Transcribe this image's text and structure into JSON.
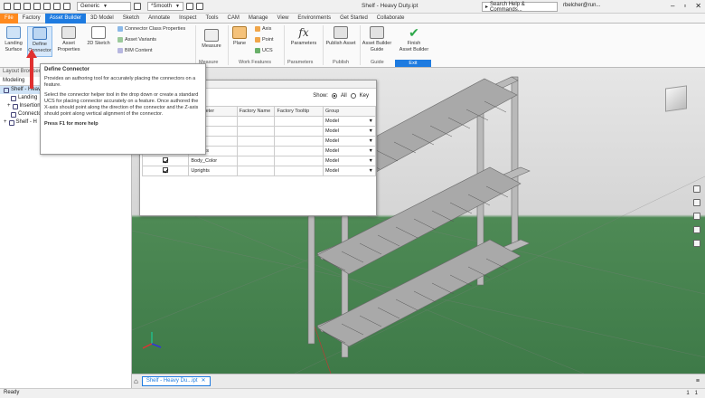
{
  "window": {
    "doc_title": "Shelf - Heavy Duty.ipt",
    "search_placeholder": "Search Help & Commands...",
    "user": "rbelcher@run...",
    "appearance_combo": "Generic",
    "style_combo": "*Smooth"
  },
  "tabs": [
    "File",
    "Factory",
    "Asset Builder",
    "3D Model",
    "Sketch",
    "Annotate",
    "Inspect",
    "Tools",
    "CAM",
    "Manage",
    "View",
    "Environments",
    "Get Started",
    "Collaborate"
  ],
  "active_tab": "Asset Builder",
  "ribbon": {
    "landing_surface": "Landing\nSurface",
    "define_connector": "Define\nConnector",
    "asset_properties": "Asset\nProperties",
    "sketch_2d": "2D Sketch",
    "connector_class_properties": "Connector Class Properties",
    "asset_variants": "Asset Variants",
    "bim_content": "BIM Content",
    "measure": "Measure",
    "plane": "Plane",
    "axis": "Axis",
    "point": "Point",
    "ucs": "UCS",
    "parameters": "Parameters",
    "publish_asset": "Publish Asset",
    "asset_builder_guide": "Asset Builder\nGuide",
    "finish_asset_builder": "Finish\nAsset Builder",
    "groups": {
      "measure": "Measure",
      "work_features": "Work Features",
      "parameters": "Parameters",
      "publish": "Publish",
      "guide": "Guide",
      "exit": "Exit"
    }
  },
  "browser": {
    "title": "Layout Browser",
    "tab": "Modeling",
    "items": [
      "Shelf - Heavy",
      "Landing",
      "Insertion",
      "Connecto",
      "Shelf - H"
    ]
  },
  "tooltip": {
    "title": "Define Connector",
    "desc": "Provides an authoring tool for accurately placing the connectors on a feature.",
    "detail": "Select the connector helper tool in the drop down or create a standard UCS for placing connector accurately on a feature. Once authored the X-axis should point along the direction of the connector and the Z-axis should point along vertical alignment of the connector.",
    "help": "Press F1 for more help"
  },
  "param_dialog": {
    "show_label": "Show:",
    "show_all": "All",
    "show_key": "Key",
    "columns": [
      "",
      "Parameter",
      "Factory Name",
      "Factory Tooltip",
      "Group"
    ],
    "rows": [
      {
        "param": "...h",
        "group": "Model"
      },
      {
        "param": "...",
        "group": "Model"
      },
      {
        "param": "...",
        "group": "Model"
      },
      {
        "param": "Shelves",
        "group": "Model"
      },
      {
        "param": "Body_Color",
        "group": "Model"
      },
      {
        "param": "Uprights",
        "group": "Model"
      }
    ]
  },
  "document_tab": "Shelf - Heavy Du...ipt",
  "status": {
    "text": "Ready",
    "count_a": "1",
    "count_b": "1"
  },
  "colors": {
    "accent": "#1e7be0",
    "file_tab": "#ff8a1f",
    "ground": "#4e8a55"
  }
}
